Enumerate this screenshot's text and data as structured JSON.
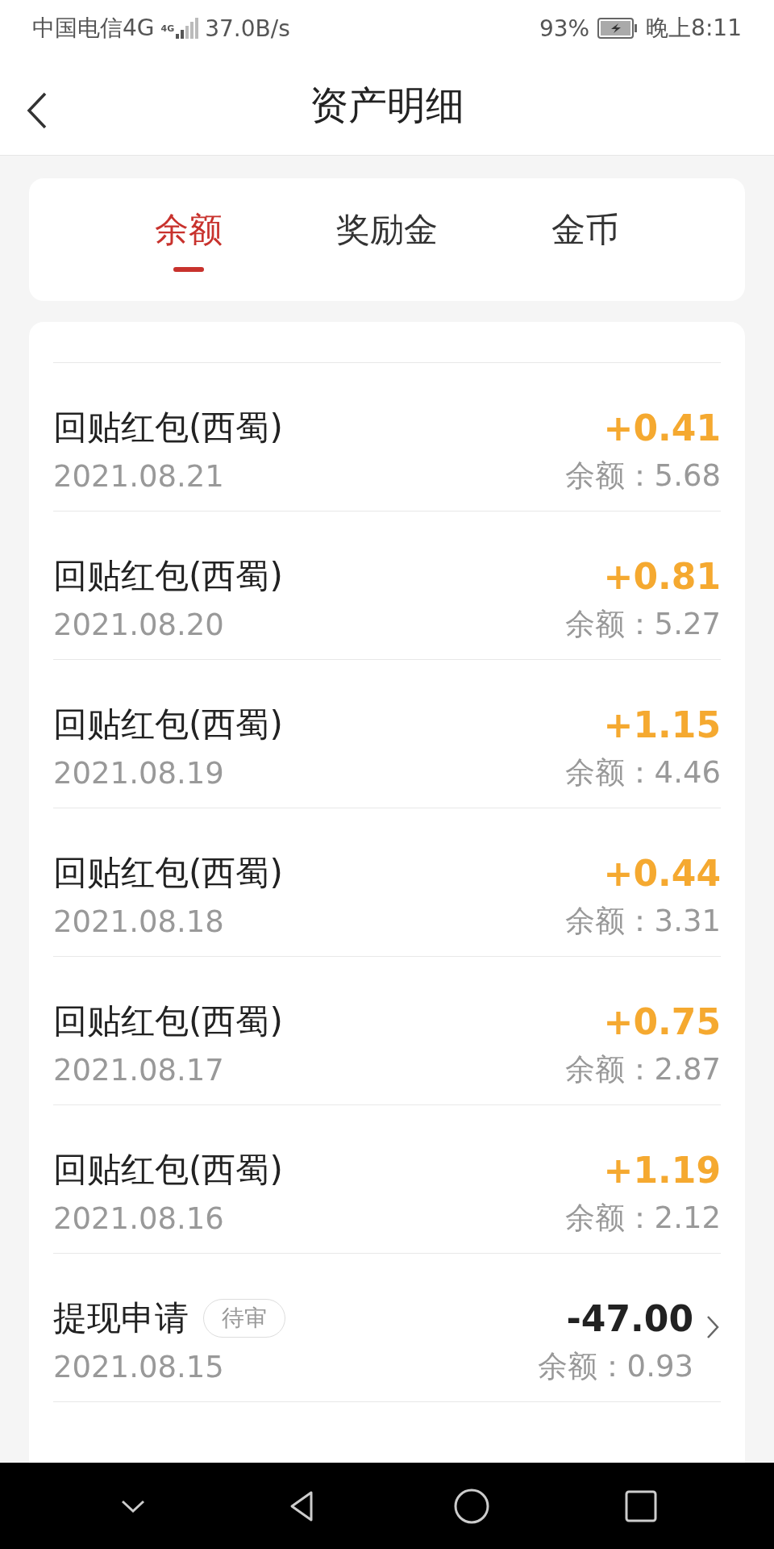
{
  "status_bar": {
    "carrier": "中国电信4G",
    "network_badge": "4G",
    "speed": "37.0B/s",
    "battery": "93%",
    "time": "晚上8:11"
  },
  "header": {
    "title": "资产明细"
  },
  "tabs": [
    {
      "label": "余额",
      "selected": true
    },
    {
      "label": "奖励金",
      "selected": false
    },
    {
      "label": "金币",
      "selected": false
    }
  ],
  "records": [
    {
      "kind": "income",
      "title": "回贴红包(西蜀)",
      "amount": "+0.41",
      "date": "2021.08.21",
      "balance": "余额：5.68"
    },
    {
      "kind": "income",
      "title": "回贴红包(西蜀)",
      "amount": "+0.81",
      "date": "2021.08.20",
      "balance": "余额：5.27"
    },
    {
      "kind": "income",
      "title": "回贴红包(西蜀)",
      "amount": "+1.15",
      "date": "2021.08.19",
      "balance": "余额：4.46"
    },
    {
      "kind": "income",
      "title": "回贴红包(西蜀)",
      "amount": "+0.44",
      "date": "2021.08.18",
      "balance": "余额：3.31"
    },
    {
      "kind": "income",
      "title": "回贴红包(西蜀)",
      "amount": "+0.75",
      "date": "2021.08.17",
      "balance": "余额：2.87"
    },
    {
      "kind": "income",
      "title": "回贴红包(西蜀)",
      "amount": "+1.19",
      "date": "2021.08.16",
      "balance": "余额：2.12"
    },
    {
      "kind": "withdrawal",
      "title": "提现申请",
      "badge": "待审",
      "amount": "-47.00",
      "date": "2021.08.15",
      "balance": "余额：0.93"
    }
  ]
}
